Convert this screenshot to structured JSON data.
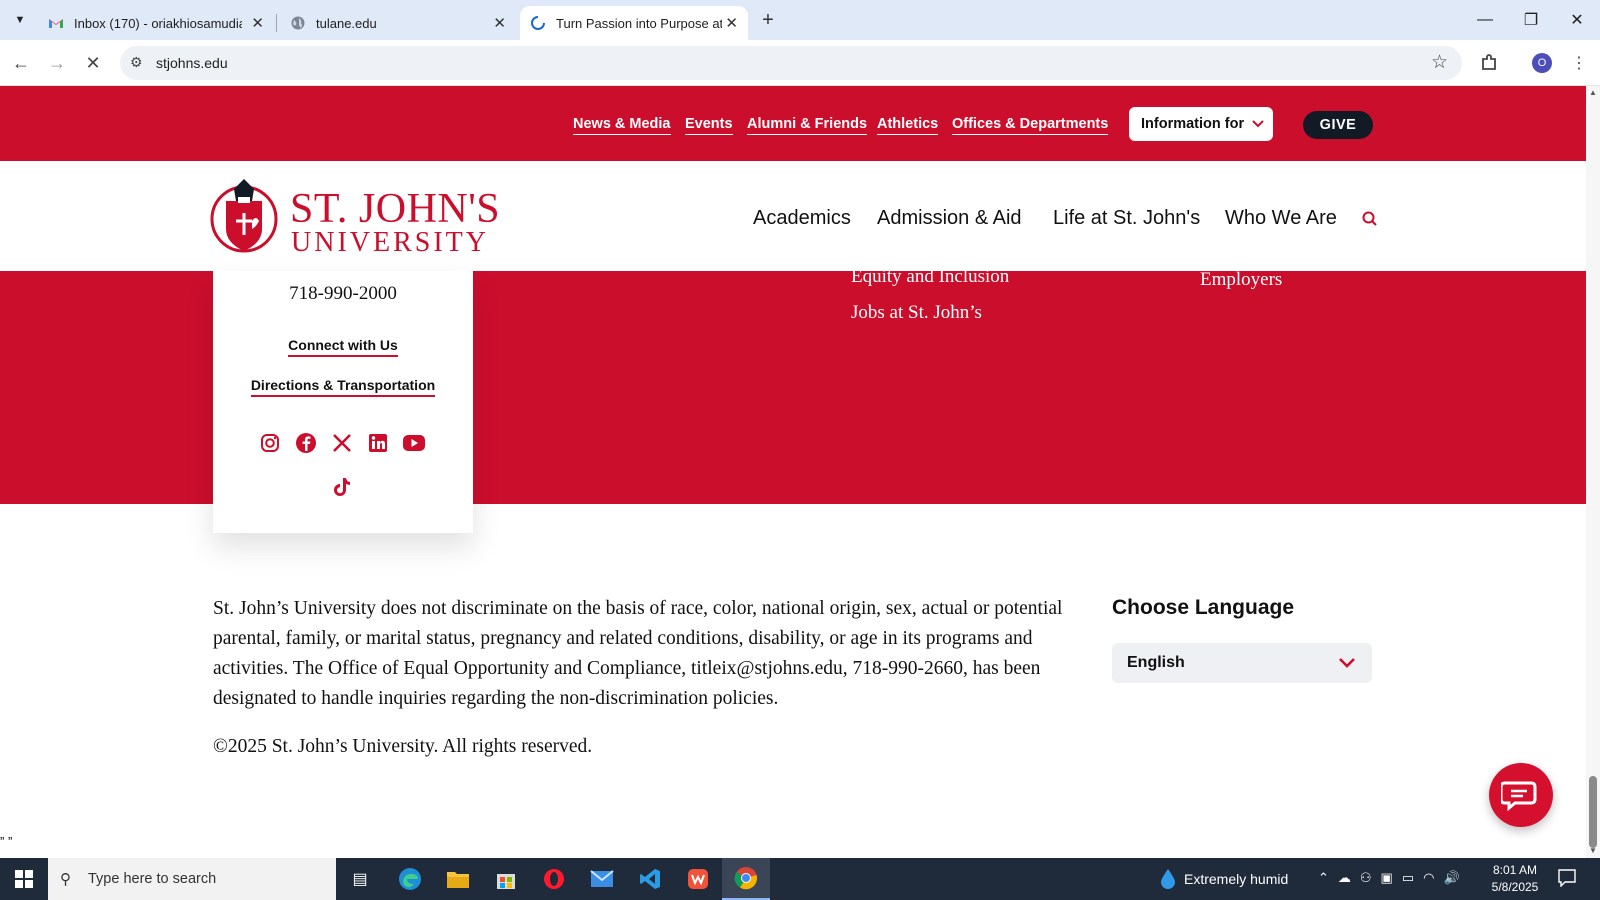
{
  "browser": {
    "tabs": [
      {
        "title": "Inbox (170) - oriakhiosamudiam",
        "favicon": "gmail-icon"
      },
      {
        "title": "tulane.edu",
        "favicon": "globe-icon"
      },
      {
        "title": "Turn Passion into Purpose at St.",
        "favicon": "loading-icon"
      }
    ],
    "url": "stjohns.edu"
  },
  "site": {
    "utility_links": [
      "News & Media",
      "Events",
      "Alumni & Friends",
      "Athletics",
      "Offices & Departments"
    ],
    "info_button": "Information for",
    "give_button": "GIVE",
    "logo": {
      "line1": "ST. JOHN'S",
      "line2": "UNIVERSITY"
    },
    "main_nav": [
      "Academics",
      "Admission & Aid",
      "Life at St. John's",
      "Who We Are"
    ]
  },
  "footer": {
    "phone": "718-990-2000",
    "connect": "Connect with Us",
    "directions": "Directions & Transportation",
    "links_col2": [
      "Equity and Inclusion",
      "Jobs at St. John’s"
    ],
    "links_col3": [
      "Employers"
    ],
    "social_icons": [
      "instagram-icon",
      "facebook-icon",
      "x-icon",
      "linkedin-icon",
      "youtube-icon",
      "tiktok-icon"
    ],
    "disclaimer": "St. John’s University does not discriminate on the basis of race, color, national origin, sex, actual or potential parental, family, or marital status, pregnancy and related conditions, disability, or age in its programs and activities. The Office of Equal Opportunity and Compliance, titleix@stjohns.edu, 718-990-2660, has been designated to handle inquiries regarding the non-discrimination policies.",
    "copyright": "©2025 St. John’s University. All rights reserved.",
    "language_title": "Choose Language",
    "language_value": "English"
  },
  "stray_text": "” ”",
  "taskbar": {
    "search_placeholder": "Type here to search",
    "weather": "Extremely humid",
    "time": "8:01 AM",
    "date": "5/8/2025"
  },
  "colors": {
    "brand_red": "#cc0e2d",
    "navy": "#121a26"
  }
}
